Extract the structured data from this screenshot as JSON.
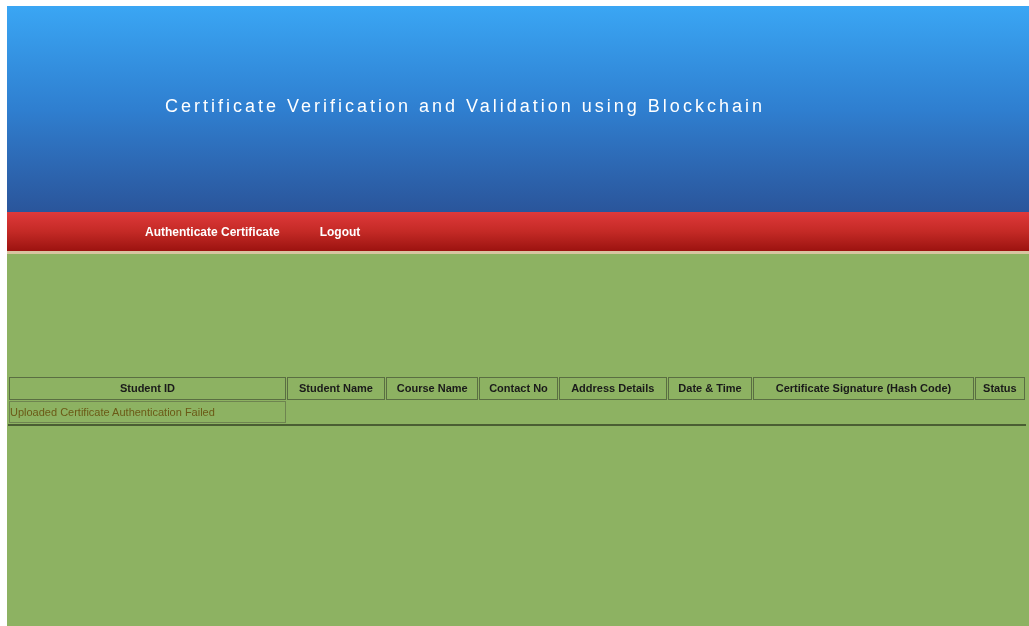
{
  "header": {
    "title": "Certificate Verification and Validation using Blockchain"
  },
  "nav": {
    "items": [
      {
        "label": "Authenticate Certificate"
      },
      {
        "label": "Logout"
      }
    ]
  },
  "table": {
    "columns": [
      "Student ID",
      "Student Name",
      "Course Name",
      "Contact No",
      "Address Details",
      "Date & Time",
      "Certificate Signature (Hash Code)",
      "Status"
    ],
    "rows": [
      {
        "message": "Uploaded Certificate Authentication Failed"
      }
    ]
  }
}
